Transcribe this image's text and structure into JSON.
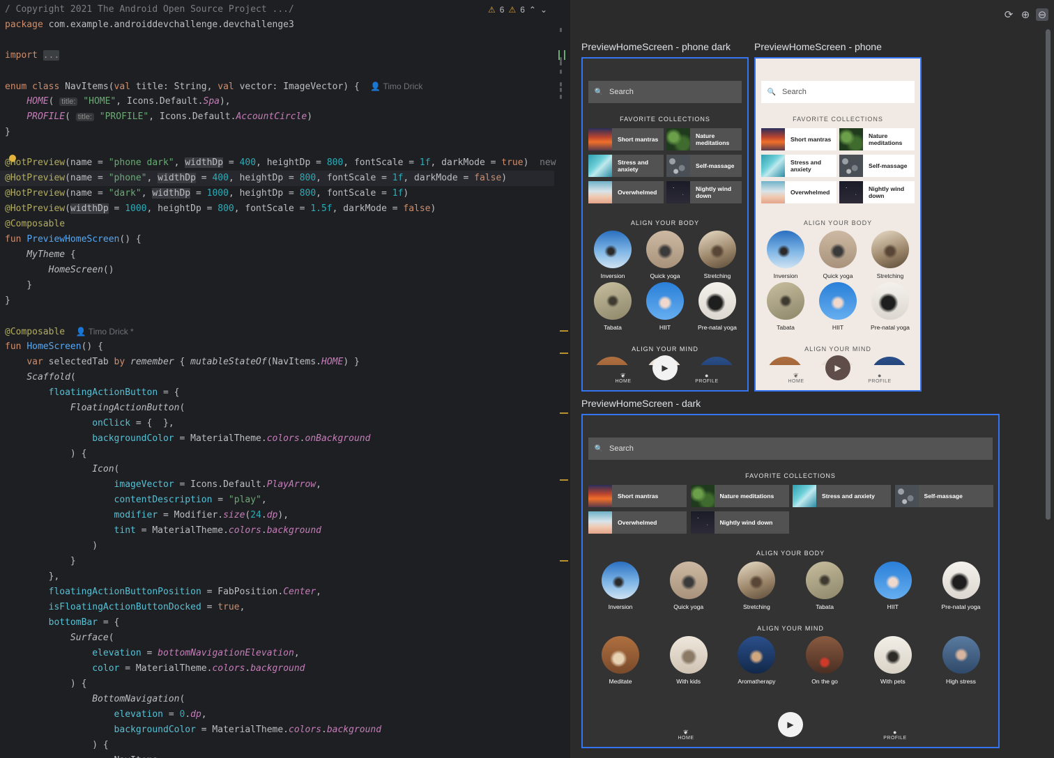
{
  "editor": {
    "inspection": {
      "warnings_a": "6",
      "warnings_b": "6",
      "up": "⌃",
      "down": "⌄"
    },
    "lines": [
      {
        "t": [
          [
            "t-cmt",
            "/ Copyright 2021 The Android Open Source Project .../"
          ]
        ]
      },
      {
        "t": [
          [
            "t-kw",
            "package "
          ],
          [
            "t-id",
            "com.example.androiddevchallenge.devchallenge3"
          ]
        ]
      },
      {
        "t": []
      },
      {
        "t": [
          [
            "t-kw",
            "import "
          ],
          [
            "t-fold",
            "..."
          ]
        ]
      },
      {
        "t": []
      },
      {
        "t": [
          [
            "t-kw",
            "enum class "
          ],
          [
            "t-id",
            "NavItems("
          ],
          [
            "t-kw",
            "val "
          ],
          [
            "t-id",
            "title: String, "
          ],
          [
            "t-kw",
            "val "
          ],
          [
            "t-id",
            "vector: ImageVector) {  "
          ],
          [
            "t-author",
            "👤 Timo Drick"
          ]
        ]
      },
      {
        "t": [
          [
            "t-id",
            "    "
          ],
          [
            "t-it",
            "HOME"
          ],
          [
            "t-id",
            "( "
          ],
          [
            "t-hint",
            "title:"
          ],
          [
            "t-str",
            " \"HOME\""
          ],
          [
            "t-id",
            ", Icons.Default."
          ],
          [
            "t-it",
            "Spa"
          ],
          [
            "t-id",
            "),"
          ]
        ]
      },
      {
        "t": [
          [
            "t-id",
            "    "
          ],
          [
            "t-it",
            "PROFILE"
          ],
          [
            "t-id",
            "( "
          ],
          [
            "t-hint",
            "title:"
          ],
          [
            "t-str",
            " \"PROFILE\""
          ],
          [
            "t-id",
            ", Icons.Default."
          ],
          [
            "t-it",
            "AccountCircle"
          ],
          [
            "t-id",
            ")"
          ]
        ]
      },
      {
        "t": [
          [
            "t-id",
            "}"
          ]
        ]
      },
      {
        "t": []
      },
      {
        "t": [
          [
            "t-ann",
            "@HotPreview"
          ],
          [
            "t-id",
            "(name = "
          ],
          [
            "t-str",
            "\"phone dark\""
          ],
          [
            "t-id",
            ", "
          ],
          [
            "t-hl",
            "widthDp"
          ],
          [
            "t-id",
            " = "
          ],
          [
            "t-num",
            "400"
          ],
          [
            "t-id",
            ", heightDp = "
          ],
          [
            "t-num",
            "800"
          ],
          [
            "t-id",
            ", fontScale = "
          ],
          [
            "t-num",
            "1f"
          ],
          [
            "t-id",
            ", darkMode = "
          ],
          [
            "t-kw",
            "true"
          ],
          [
            "t-id",
            ")  "
          ],
          [
            "t-cmt",
            "new"
          ]
        ]
      },
      {
        "t": [
          [
            "t-ann",
            "@HotPreview"
          ],
          [
            "t-id",
            "(name = "
          ],
          [
            "t-str",
            "\"phone\""
          ],
          [
            "t-id",
            ", "
          ],
          [
            "t-hl",
            "widthDp"
          ],
          [
            "t-id",
            " = "
          ],
          [
            "t-num",
            "400"
          ],
          [
            "t-id",
            ", heightDp = "
          ],
          [
            "t-num",
            "800"
          ],
          [
            "t-id",
            ", fontScale = "
          ],
          [
            "t-num",
            "1f"
          ],
          [
            "t-id",
            ", darkMode = "
          ],
          [
            "t-kw",
            "false"
          ],
          [
            "t-id",
            ")"
          ]
        ]
      },
      {
        "t": [
          [
            "t-ann",
            "@HotPreview"
          ],
          [
            "t-id",
            "(name = "
          ],
          [
            "t-str",
            "\"dark\""
          ],
          [
            "t-id",
            ", "
          ],
          [
            "t-hl",
            "widthDp"
          ],
          [
            "t-id",
            " = "
          ],
          [
            "t-num",
            "1000"
          ],
          [
            "t-id",
            ", heightDp = "
          ],
          [
            "t-num",
            "800"
          ],
          [
            "t-id",
            ", fontScale = "
          ],
          [
            "t-num",
            "1f"
          ],
          [
            "t-id",
            ")"
          ]
        ]
      },
      {
        "t": [
          [
            "t-ann",
            "@HotPreview"
          ],
          [
            "t-id",
            "("
          ],
          [
            "t-hl",
            "widthDp"
          ],
          [
            "t-id",
            " = "
          ],
          [
            "t-num",
            "1000"
          ],
          [
            "t-id",
            ", heightDp = "
          ],
          [
            "t-num",
            "800"
          ],
          [
            "t-id",
            ", fontScale = "
          ],
          [
            "t-num",
            "1.5f"
          ],
          [
            "t-id",
            ", darkMode = "
          ],
          [
            "t-kw",
            "false"
          ],
          [
            "t-id",
            ")"
          ]
        ]
      },
      {
        "t": [
          [
            "t-ann",
            "@Composable"
          ]
        ]
      },
      {
        "t": [
          [
            "t-kw",
            "fun "
          ],
          [
            "t-fn",
            "PreviewHomeScreen"
          ],
          [
            "t-id",
            "() {"
          ]
        ]
      },
      {
        "t": [
          [
            "t-id",
            "    "
          ],
          [
            "t-call",
            "MyTheme"
          ],
          [
            "t-id",
            " {"
          ]
        ]
      },
      {
        "t": [
          [
            "t-id",
            "        "
          ],
          [
            "t-call",
            "HomeScreen"
          ],
          [
            "t-id",
            "()"
          ]
        ]
      },
      {
        "t": [
          [
            "t-id",
            "    }"
          ]
        ]
      },
      {
        "t": [
          [
            "t-id",
            "}"
          ]
        ]
      },
      {
        "t": []
      },
      {
        "t": [
          [
            "t-ann",
            "@Composable  "
          ],
          [
            "t-author",
            "👤 Timo Drick *"
          ]
        ]
      },
      {
        "t": [
          [
            "t-kw",
            "fun "
          ],
          [
            "t-fn",
            "HomeScreen"
          ],
          [
            "t-id",
            "() {"
          ]
        ]
      },
      {
        "t": [
          [
            "t-id",
            "    "
          ],
          [
            "t-kw",
            "var "
          ],
          [
            "t-id",
            "selectedTab "
          ],
          [
            "t-kw",
            "by "
          ],
          [
            "t-call",
            "remember"
          ],
          [
            "t-id",
            " { "
          ],
          [
            "t-call",
            "mutableStateOf"
          ],
          [
            "t-id",
            "(NavItems."
          ],
          [
            "t-it",
            "HOME"
          ],
          [
            "t-id",
            ") }"
          ]
        ]
      },
      {
        "t": [
          [
            "t-id",
            "    "
          ],
          [
            "t-call",
            "Scaffold"
          ],
          [
            "t-id",
            "("
          ]
        ]
      },
      {
        "t": [
          [
            "t-id",
            "        "
          ],
          [
            "t-prm",
            "floatingActionButton"
          ],
          [
            "t-id",
            " = {"
          ]
        ]
      },
      {
        "t": [
          [
            "t-id",
            "            "
          ],
          [
            "t-call",
            "FloatingActionButton"
          ],
          [
            "t-id",
            "("
          ]
        ]
      },
      {
        "t": [
          [
            "t-id",
            "                "
          ],
          [
            "t-prm",
            "onClick"
          ],
          [
            "t-id",
            " = {  },"
          ]
        ]
      },
      {
        "t": [
          [
            "t-id",
            "                "
          ],
          [
            "t-prm",
            "backgroundColor"
          ],
          [
            "t-id",
            " = MaterialTheme."
          ],
          [
            "t-it",
            "colors"
          ],
          [
            "t-id",
            "."
          ],
          [
            "t-it",
            "onBackground"
          ]
        ]
      },
      {
        "t": [
          [
            "t-id",
            "            ) {"
          ]
        ]
      },
      {
        "t": [
          [
            "t-id",
            "                "
          ],
          [
            "t-call",
            "Icon"
          ],
          [
            "t-id",
            "("
          ]
        ]
      },
      {
        "t": [
          [
            "t-id",
            "                    "
          ],
          [
            "t-prm",
            "imageVector"
          ],
          [
            "t-id",
            " = Icons.Default."
          ],
          [
            "t-it",
            "PlayArrow"
          ],
          [
            "t-id",
            ","
          ]
        ]
      },
      {
        "t": [
          [
            "t-id",
            "                    "
          ],
          [
            "t-prm",
            "contentDescription"
          ],
          [
            "t-id",
            " = "
          ],
          [
            "t-str",
            "\"play\""
          ],
          [
            "t-id",
            ","
          ]
        ]
      },
      {
        "t": [
          [
            "t-id",
            "                    "
          ],
          [
            "t-prm",
            "modifier"
          ],
          [
            "t-id",
            " = Modifier."
          ],
          [
            "t-it",
            "size"
          ],
          [
            "t-id",
            "("
          ],
          [
            "t-num",
            "24"
          ],
          [
            "t-id",
            "."
          ],
          [
            "t-it",
            "dp"
          ],
          [
            "t-id",
            "),"
          ]
        ]
      },
      {
        "t": [
          [
            "t-id",
            "                    "
          ],
          [
            "t-prm",
            "tint"
          ],
          [
            "t-id",
            " = MaterialTheme."
          ],
          [
            "t-it",
            "colors"
          ],
          [
            "t-id",
            "."
          ],
          [
            "t-it",
            "background"
          ]
        ]
      },
      {
        "t": [
          [
            "t-id",
            "                )"
          ]
        ]
      },
      {
        "t": [
          [
            "t-id",
            "            }"
          ]
        ]
      },
      {
        "t": [
          [
            "t-id",
            "        },"
          ]
        ]
      },
      {
        "t": [
          [
            "t-id",
            "        "
          ],
          [
            "t-prm",
            "floatingActionButtonPosition"
          ],
          [
            "t-id",
            " = FabPosition."
          ],
          [
            "t-it",
            "Center"
          ],
          [
            "t-id",
            ","
          ]
        ]
      },
      {
        "t": [
          [
            "t-id",
            "        "
          ],
          [
            "t-prm",
            "isFloatingActionButtonDocked"
          ],
          [
            "t-id",
            " = "
          ],
          [
            "t-kw",
            "true"
          ],
          [
            "t-id",
            ","
          ]
        ]
      },
      {
        "t": [
          [
            "t-id",
            "        "
          ],
          [
            "t-prm",
            "bottomBar"
          ],
          [
            "t-id",
            " = {"
          ]
        ]
      },
      {
        "t": [
          [
            "t-id",
            "            "
          ],
          [
            "t-call",
            "Surface"
          ],
          [
            "t-id",
            "("
          ]
        ]
      },
      {
        "t": [
          [
            "t-id",
            "                "
          ],
          [
            "t-prm",
            "elevation"
          ],
          [
            "t-id",
            " = "
          ],
          [
            "t-it",
            "bottomNavigationElevation"
          ],
          [
            "t-id",
            ","
          ]
        ]
      },
      {
        "t": [
          [
            "t-id",
            "                "
          ],
          [
            "t-prm",
            "color"
          ],
          [
            "t-id",
            " = MaterialTheme."
          ],
          [
            "t-it",
            "colors"
          ],
          [
            "t-id",
            "."
          ],
          [
            "t-it",
            "background"
          ]
        ]
      },
      {
        "t": [
          [
            "t-id",
            "            ) {"
          ]
        ]
      },
      {
        "t": [
          [
            "t-id",
            "                "
          ],
          [
            "t-call",
            "BottomNavigation"
          ],
          [
            "t-id",
            "("
          ]
        ]
      },
      {
        "t": [
          [
            "t-id",
            "                    "
          ],
          [
            "t-prm",
            "elevation"
          ],
          [
            "t-id",
            " = "
          ],
          [
            "t-num",
            "0"
          ],
          [
            "t-id",
            "."
          ],
          [
            "t-it",
            "dp"
          ],
          [
            "t-id",
            ","
          ]
        ]
      },
      {
        "t": [
          [
            "t-id",
            "                    "
          ],
          [
            "t-prm",
            "backgroundColor"
          ],
          [
            "t-id",
            " = MaterialTheme."
          ],
          [
            "t-it",
            "colors"
          ],
          [
            "t-id",
            "."
          ],
          [
            "t-it",
            "background"
          ]
        ]
      },
      {
        "t": [
          [
            "t-id",
            "                ) {"
          ]
        ]
      },
      {
        "t": [
          [
            "t-id",
            "                    NavItems."
          ]
        ]
      }
    ]
  },
  "preview": {
    "tools": [
      "⟳",
      "⊕",
      "⊖"
    ],
    "titles": {
      "phone_dark": "PreviewHomeScreen  - phone dark",
      "phone": "PreviewHomeScreen  - phone",
      "dark": "PreviewHomeScreen  - dark"
    },
    "app": {
      "search_placeholder": "Search",
      "search_icon": "🔍",
      "fav_title": "FAVORITE COLLECTIONS",
      "body_title": "ALIGN YOUR BODY",
      "mind_title": "ALIGN YOUR MIND",
      "fab_icon": "▶",
      "nav": [
        {
          "label": "HOME",
          "icon": "spa-icon"
        },
        {
          "label": "PROFILE",
          "icon": "account-circle-icon"
        }
      ],
      "collections": [
        {
          "name": "Short mantras",
          "img": "sunset"
        },
        {
          "name": "Nature meditations",
          "img": "nature"
        },
        {
          "name": "Stress and anxiety",
          "img": "ocean"
        },
        {
          "name": "Self-massage",
          "img": "stones"
        },
        {
          "name": "Overwhelmed",
          "img": "cloud"
        },
        {
          "name": "Nightly wind down",
          "img": "night"
        }
      ],
      "body": [
        {
          "name": "Inversion",
          "img": "inv"
        },
        {
          "name": "Quick yoga",
          "img": "quick"
        },
        {
          "name": "Stretching",
          "img": "stretch"
        },
        {
          "name": "Tabata",
          "img": "tabata"
        },
        {
          "name": "HIIT",
          "img": "hiit"
        },
        {
          "name": "Pre-natal yoga",
          "img": "prenatal"
        }
      ],
      "mind": [
        {
          "name": "Meditate",
          "img": "meditate"
        },
        {
          "name": "With kids",
          "img": "kids"
        },
        {
          "name": "Aromatherapy",
          "img": "aroma"
        },
        {
          "name": "On the go",
          "img": "onthego"
        },
        {
          "name": "With pets",
          "img": "pets"
        },
        {
          "name": "High stress",
          "img": "stress"
        }
      ]
    },
    "colors": {
      "frame": "#3574f0",
      "dark_bg": "#333333",
      "light_bg": "#f1e9e3"
    }
  }
}
